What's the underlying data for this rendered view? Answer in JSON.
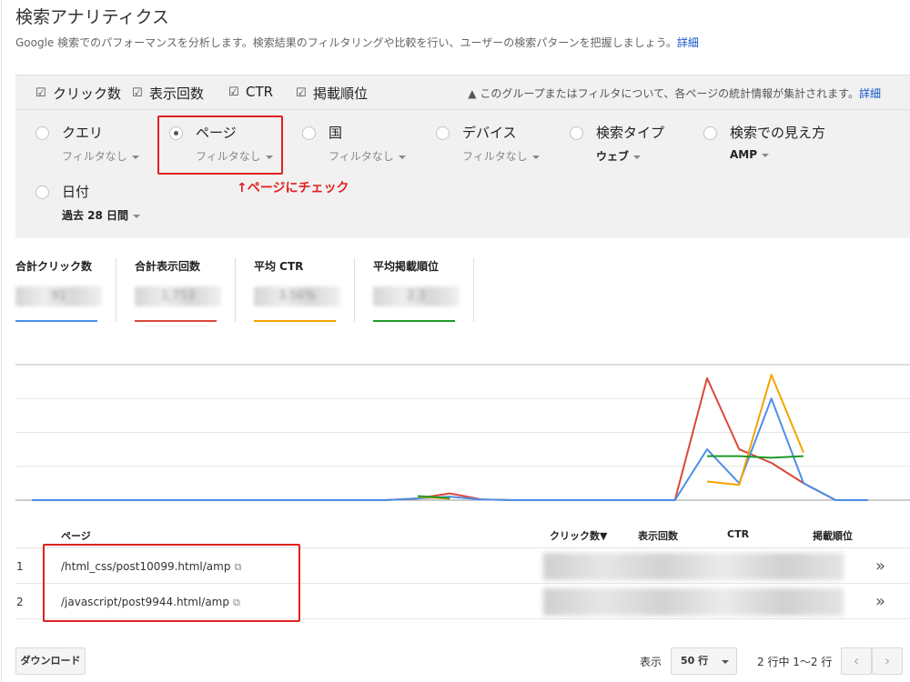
{
  "header": {
    "title": "検索アナリティクス",
    "description": "Google 検索でのパフォーマンスを分析します。検索結果のフィルタリングや比較を行い、ユーザーの検索パターンを把握しましょう。",
    "detail_link": "詳細"
  },
  "metrics_checkboxes": [
    {
      "label": "クリック数",
      "checked": true
    },
    {
      "label": "表示回数",
      "checked": true
    },
    {
      "label": "CTR",
      "checked": true
    },
    {
      "label": "掲載順位",
      "checked": true
    }
  ],
  "notice": {
    "text": "このグループまたはフィルタについて、各ページの統計情報が集計されます。",
    "link": "詳細"
  },
  "dimensions": [
    {
      "name": "クエリ",
      "filter": "フィルタなし",
      "selected": false
    },
    {
      "name": "ページ",
      "filter": "フィルタなし",
      "selected": true
    },
    {
      "name": "国",
      "filter": "フィルタなし",
      "selected": false
    },
    {
      "name": "デバイス",
      "filter": "フィルタなし",
      "selected": false
    },
    {
      "name": "検索タイプ",
      "filter": "ウェブ",
      "selected": false
    },
    {
      "name": "検索での見え方",
      "filter": "AMP",
      "selected": false
    },
    {
      "name": "日付",
      "filter": "過去 28 日間",
      "selected": false
    }
  ],
  "annotation": "↑ページにチェック",
  "totals": [
    {
      "label": "合計クリック数",
      "value": "91",
      "color": "#4a8fe7"
    },
    {
      "label": "合計表示回数",
      "value": "1,753",
      "color": "#d9473a"
    },
    {
      "label": "平均 CTR",
      "value": "3.56%",
      "color": "#f4a300"
    },
    {
      "label": "平均掲載順位",
      "value": "2.3",
      "color": "#1e9a2b"
    }
  ],
  "chart_data": {
    "type": "line",
    "x_count": 28,
    "series": [
      {
        "color": "#d9473a",
        "values": [
          0,
          0,
          0,
          0,
          0,
          0,
          0,
          0,
          0,
          0,
          0,
          0,
          0.5,
          2,
          0.2,
          0,
          0,
          0,
          0,
          0,
          0,
          36,
          15,
          11,
          5,
          0,
          0,
          null
        ]
      },
      {
        "color": "#4a8fe7",
        "values": [
          0,
          0,
          0,
          0,
          0,
          0,
          0,
          0,
          0,
          0,
          0,
          0,
          0.5,
          1,
          0.2,
          0,
          0,
          0,
          0,
          0,
          0,
          15,
          5,
          30,
          5,
          0,
          0,
          null
        ]
      },
      {
        "color": "#f4a300",
        "values": [
          null,
          null,
          null,
          null,
          null,
          null,
          null,
          null,
          null,
          null,
          null,
          null,
          1,
          0.4,
          null,
          null,
          null,
          null,
          null,
          null,
          null,
          5.5,
          4.5,
          37,
          14,
          null,
          null,
          null
        ]
      },
      {
        "color": "#1e9a2b",
        "values": [
          null,
          null,
          null,
          null,
          null,
          null,
          null,
          null,
          null,
          null,
          null,
          null,
          1.2,
          0.6,
          null,
          null,
          null,
          null,
          null,
          null,
          null,
          13,
          13,
          12.5,
          13,
          null,
          null,
          null
        ]
      }
    ],
    "ylim": [
      0,
      40
    ],
    "grid": true
  },
  "table": {
    "columns": [
      "ページ",
      "クリック数▼",
      "表示回数",
      "CTR",
      "掲載順位"
    ],
    "rows": [
      {
        "num": "1",
        "page": "/html_css/post10099.html/amp",
        "clicks": "80",
        "impressions": "1,576",
        "ctr": "5.08%",
        "position": "2.2"
      },
      {
        "num": "2",
        "page": "/javascript/post9944.html/amp",
        "clicks": "11",
        "impressions": "177",
        "ctr": "6.21%",
        "position": "2.7"
      }
    ]
  },
  "footer": {
    "download": "ダウンロード",
    "show_label": "表示",
    "rows_option": "50 行",
    "pagination": "2 行中 1〜2 行"
  }
}
